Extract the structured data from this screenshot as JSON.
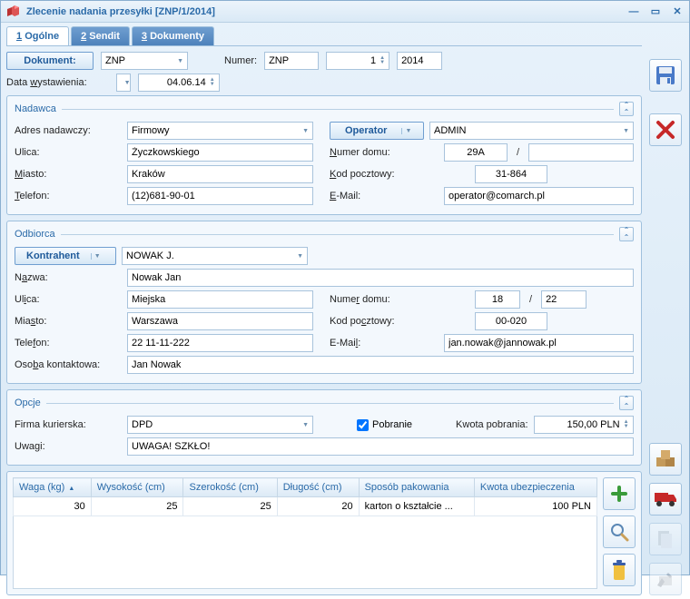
{
  "window": {
    "title": "Zlecenie nadania przesyłki [ZNP/1/2014]"
  },
  "tabs": {
    "t1_num": "1",
    "t1_label": "Ogólne",
    "t2_num": "2",
    "t2_label": "Sendit",
    "t3_num": "3",
    "t3_label": "Dokumenty"
  },
  "docrow": {
    "btn_dokument": "Dokument:",
    "doc_type": "ZNP",
    "lbl_numer": "Numer:",
    "numer_prefix": "ZNP",
    "numer_seq": "1",
    "numer_year": "2014",
    "lbl_data": "Data wystawienia:",
    "data_value": "04.06.14"
  },
  "nadawca": {
    "title": "Nadawca",
    "lbl_adres": "Adres nadawczy:",
    "adres_value": "Firmowy",
    "btn_operator": "Operator",
    "operator_value": "ADMIN",
    "lbl_ulica": "Ulica:",
    "ulica_value": "Życzkowskiego",
    "lbl_numer_domu": "Numer domu:",
    "numer_domu_value": "29A",
    "numer_domu2_value": "",
    "lbl_miasto": "Miasto:",
    "miasto_value": "Kraków",
    "lbl_kod": "Kod pocztowy:",
    "kod_value": "31-864",
    "lbl_tel": "Telefon:",
    "tel_value": "(12)681-90-01",
    "lbl_email": "E-Mail:",
    "email_value": "operator@comarch.pl"
  },
  "odbiorca": {
    "title": "Odbiorca",
    "btn_kontrahent": "Kontrahent",
    "kontrahent_value": "NOWAK J.",
    "lbl_nazwa": "Nazwa:",
    "nazwa_value": "Nowak Jan",
    "lbl_ulica": "Ulica:",
    "ulica_value": "Miejska",
    "lbl_numer_domu": "Numer domu:",
    "numer_domu_value": "18",
    "numer_domu2_value": "22",
    "lbl_miasto": "Miasto:",
    "miasto_value": "Warszawa",
    "lbl_kod": "Kod pocztowy:",
    "kod_value": "00-020",
    "lbl_tel": "Telefon:",
    "tel_value": "22 11-11-222",
    "lbl_email": "E-Mail:",
    "email_value": "jan.nowak@jannowak.pl",
    "lbl_osoba": "Osoba kontaktowa:",
    "osoba_value": "Jan Nowak"
  },
  "opcje": {
    "title": "Opcje",
    "lbl_firma": "Firma kurierska:",
    "firma_value": "DPD",
    "chk_pobranie": "Pobranie",
    "lbl_kwota": "Kwota pobrania:",
    "kwota_value": "150,00 PLN",
    "lbl_uwagi": "Uwagi:",
    "uwagi_value": "UWAGA! SZKŁO!"
  },
  "table": {
    "cols": {
      "waga": "Waga (kg)",
      "wys": "Wysokość (cm)",
      "szer": "Szerokość (cm)",
      "dlug": "Długość (cm)",
      "sposob": "Sposób pakowania",
      "kwota": "Kwota ubezpieczenia"
    },
    "row": {
      "waga": "30",
      "wys": "25",
      "szer": "25",
      "dlug": "20",
      "sposob": "karton o kształcie ...",
      "kwota": "100 PLN"
    }
  }
}
